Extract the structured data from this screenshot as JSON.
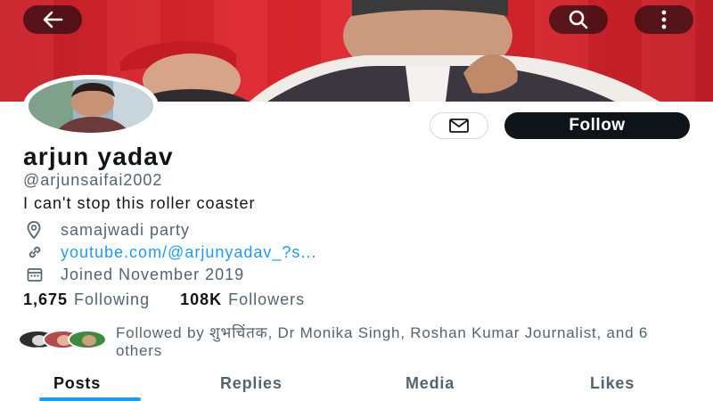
{
  "header": {
    "back_icon": "arrow-left-icon",
    "search_icon": "search-icon",
    "more_icon": "more-vertical-icon"
  },
  "profile": {
    "name": "arjun yadav",
    "handle": "@arjunsaifai2002",
    "bio": "I can't stop this roller coaster",
    "location": "samajwadi party",
    "link": "youtube.com/@arjunyadav_?s...",
    "joined": "Joined November 2019",
    "following_count": "1,675",
    "following_label": "Following",
    "followers_count": "108K",
    "followers_label": "Followers",
    "followed_by": "Followed by शुभचिंतक, Dr Monika Singh, Roshan Kumar Journalist, and 6 others"
  },
  "actions": {
    "message_icon": "mail-icon",
    "follow_label": "Follow"
  },
  "tabs": [
    {
      "label": "Posts",
      "active": true
    },
    {
      "label": "Replies",
      "active": false
    },
    {
      "label": "Media",
      "active": false
    },
    {
      "label": "Likes",
      "active": false
    }
  ],
  "colors": {
    "banner_red": "#d8242c",
    "accent_blue": "#1d9bf0",
    "follow_button": "#0f1419"
  }
}
